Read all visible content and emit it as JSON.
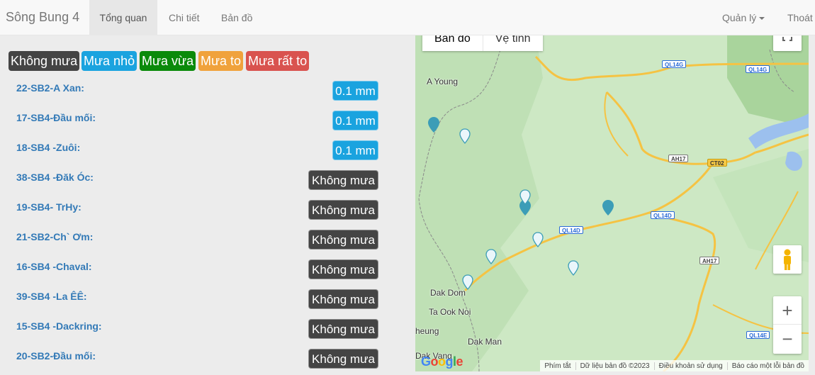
{
  "navbar": {
    "brand": "Sông Bung 4",
    "tabs": [
      {
        "label": "Tổng quan",
        "active": true
      },
      {
        "label": "Chi tiết",
        "active": false
      },
      {
        "label": "Bản đồ",
        "active": false
      }
    ],
    "manage_label": "Quản lý",
    "logout_label": "Thoát"
  },
  "legend": [
    {
      "label": "Không mưa",
      "color": "#444444"
    },
    {
      "label": "Mưa nhỏ",
      "color": "#1aa3df"
    },
    {
      "label": "Mưa vừa",
      "color": "#0a8a0a"
    },
    {
      "label": "Mưa to",
      "color": "#f0a23c"
    },
    {
      "label": "Mưa rất to",
      "color": "#d9534f"
    }
  ],
  "stations": [
    {
      "name": "22-SB2-A Xan:",
      "value": "0.1 mm",
      "level": "blue"
    },
    {
      "name": "17-SB4-Đầu mối:",
      "value": "0.1 mm",
      "level": "blue"
    },
    {
      "name": "18-SB4 -Zuôi:",
      "value": "0.1 mm",
      "level": "blue"
    },
    {
      "name": "38-SB4 -Đăk Óc:",
      "value": "Không mưa",
      "level": "dark"
    },
    {
      "name": "19-SB4- TrHy:",
      "value": "Không mưa",
      "level": "dark"
    },
    {
      "name": "21-SB2-Ch` Ơm:",
      "value": "Không mưa",
      "level": "dark"
    },
    {
      "name": "16-SB4 -Chaval:",
      "value": "Không mưa",
      "level": "dark"
    },
    {
      "name": "39-SB4 -La ÊÊ:",
      "value": "Không mưa",
      "level": "dark"
    },
    {
      "name": "15-SB4 -Dackring:",
      "value": "Không mưa",
      "level": "dark"
    },
    {
      "name": "20-SB2-Đầu mối:",
      "value": "Không mưa",
      "level": "dark"
    }
  ],
  "map": {
    "type_map": "Bản đồ",
    "type_satellite": "Vệ tinh",
    "zoom_in": "+",
    "zoom_out": "−",
    "place_labels": [
      "A Young",
      "Dak Dom",
      "Ta Ook Noi",
      "Dak Man",
      "heung",
      "Dak Vang"
    ],
    "road_shields": [
      "QL14G",
      "QL14G",
      "AH17",
      "CT02",
      "QL14D",
      "QL14D",
      "AH17",
      "QL14E"
    ],
    "footer": {
      "shortcuts": "Phím tắt",
      "data": "Dữ liệu bản đồ ©2023",
      "terms": "Điều khoản sử dụng",
      "report": "Báo cáo một lỗi bản đồ"
    },
    "google": "Google"
  }
}
